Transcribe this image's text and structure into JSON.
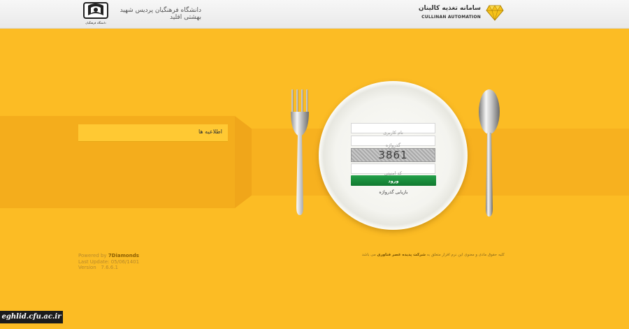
{
  "header": {
    "university_name": "دانشگاه فرهنگیان پردیس شهید بهشتی اقلید",
    "university_logo_text": "دانشگاه فرهنگیان",
    "brand_title": "سامانه تغذیه کالینان",
    "brand_subtitle": "CULLINAN AUTOMATION",
    "brand_logo_icon": "diamond-icon"
  },
  "news": {
    "title": "اطلاعیه ها"
  },
  "login": {
    "username_placeholder": "نام کاربری",
    "password_placeholder": "گذرواژه",
    "captcha_code": "3861",
    "security_code_placeholder": "کد امنیتی",
    "login_button": "ورود",
    "recover_password": "بازیابی گذرواژه"
  },
  "footer": {
    "powered_label": "Powered by",
    "powered_brand": "7Diamonds",
    "last_update": "Last Update: 05/06/1401",
    "version": "Version   7.6.6.1",
    "copyright_prefix": "کلیه حقوق مادی و معنوی این نرم افزار متعلق به",
    "copyright_company": "شرکت پدیده عصر فناوری",
    "copyright_suffix": "می باشد"
  },
  "watermark": {
    "text": "eghlid.cfu.ac.ir"
  },
  "colors": {
    "background": "#fcbc24",
    "button_green": "#1a8c3c"
  }
}
